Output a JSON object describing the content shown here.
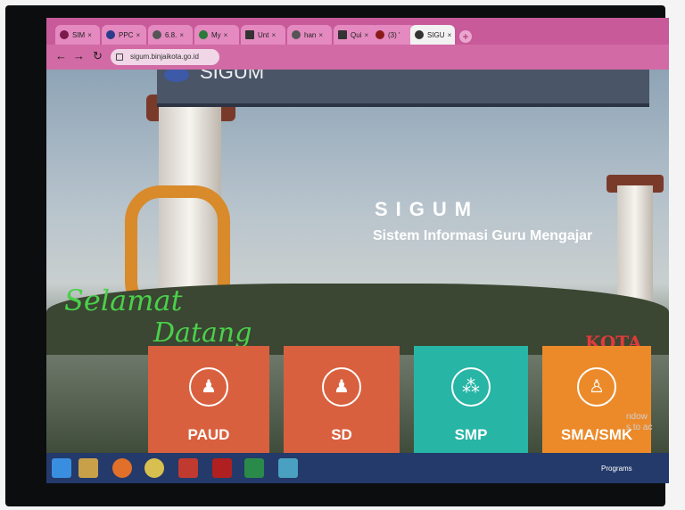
{
  "browser": {
    "tabs": [
      {
        "label": "SIM",
        "icon": "v-icon",
        "color": "#7a1a4a"
      },
      {
        "label": "PPC",
        "icon": "globe-icon",
        "color": "#2a3c8a"
      },
      {
        "label": "6.8.",
        "icon": "image-icon",
        "color": "#555555"
      },
      {
        "label": "My",
        "icon": "drive-icon",
        "color": "#2a7a3a"
      },
      {
        "label": "Unt",
        "icon": "doc-icon",
        "color": "#333333"
      },
      {
        "label": "han",
        "icon": "google-icon",
        "color": "#555555"
      },
      {
        "label": "Qui",
        "icon": "quiz-icon",
        "color": "#333333"
      },
      {
        "label": "(3) '",
        "icon": "notification-icon",
        "color": "#8a1a1a"
      },
      {
        "label": "SIGU",
        "icon": "site-icon",
        "color": "#333333"
      }
    ],
    "new_tab": "+",
    "url": "sigum.binjaikota.go.id"
  },
  "site": {
    "header_word": "SIGUM",
    "title": "SIGUM",
    "subtitle": "Sistem Informasi Guru Mengajar",
    "welcome_line1": "Selamat",
    "welcome_line2": "Datang",
    "kota_sign": "KOTA BIN",
    "cards": [
      {
        "label": "PAUD",
        "icon": "child-icon",
        "color": "#d9603e"
      },
      {
        "label": "SD",
        "icon": "child-icon",
        "color": "#d9603e"
      },
      {
        "label": "SMP",
        "icon": "group-icon",
        "color": "#27b5a6"
      },
      {
        "label": "SMA/SMK",
        "icon": "person-icon",
        "color": "#ec8a2a"
      }
    ],
    "watermark_line1": "ndow",
    "watermark_line2": "s to ac"
  },
  "taskbar": {
    "programs_label": "Programs",
    "icons": [
      "windows-icon",
      "file-explorer-icon",
      "firefox-icon",
      "chrome-icon",
      "media-player-icon",
      "pdf-reader-icon",
      "spreadsheet-icon",
      "paint-icon"
    ]
  }
}
